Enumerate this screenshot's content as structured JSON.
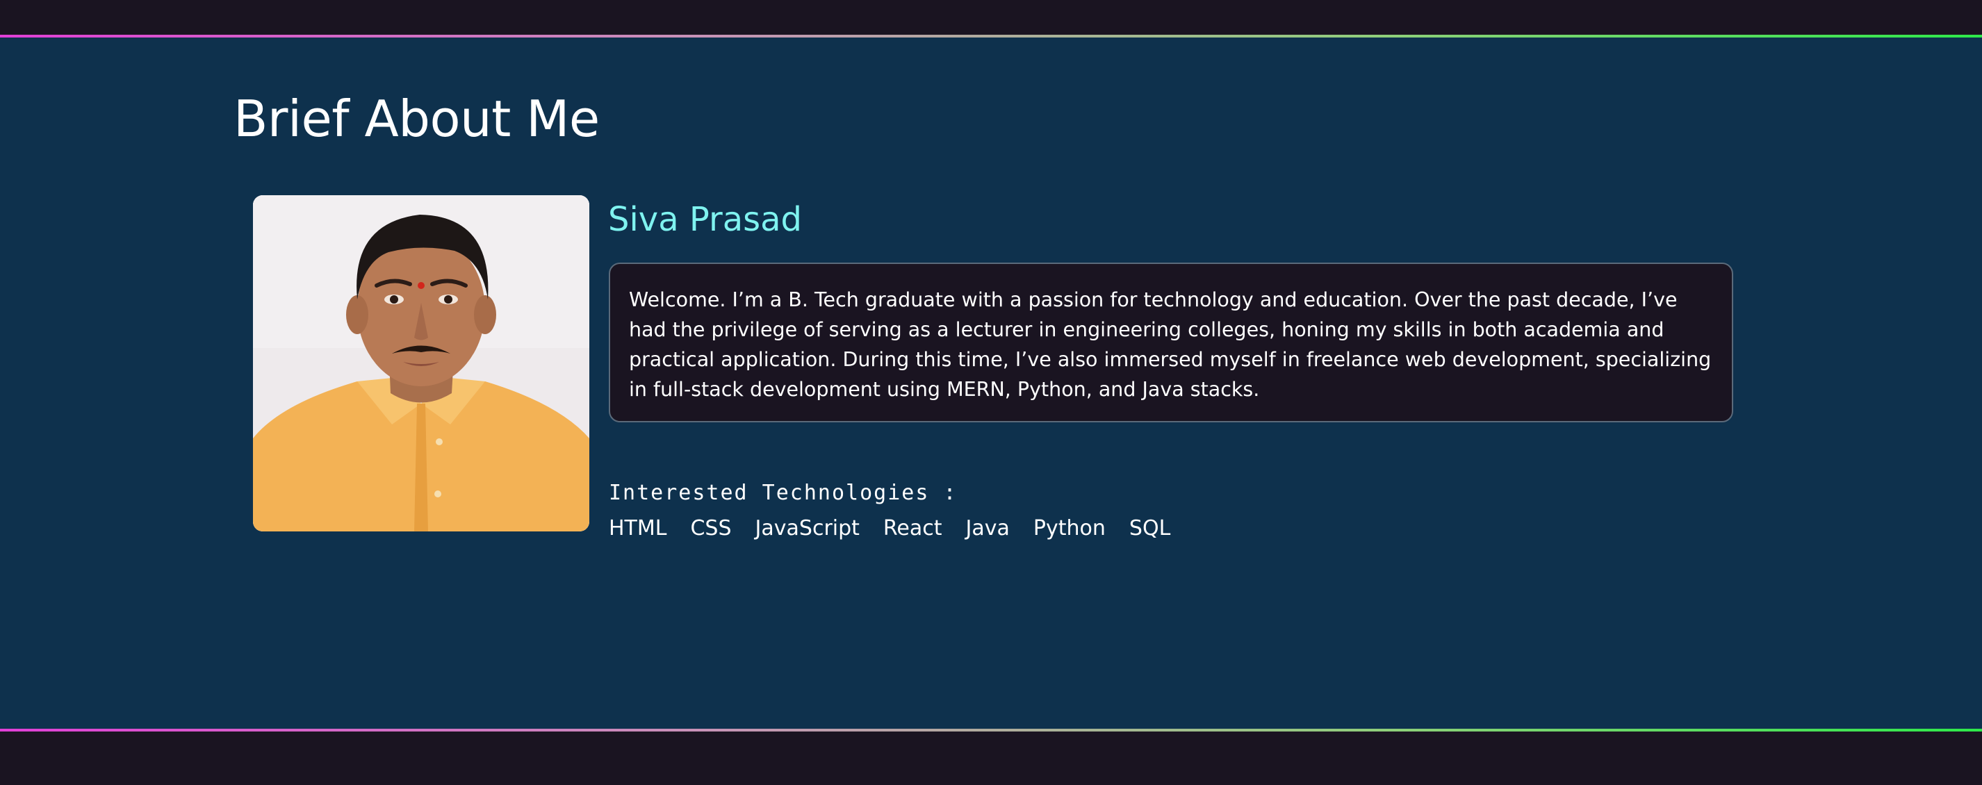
{
  "about": {
    "title": "Brief About Me",
    "name": "Siva Prasad",
    "bio": "Welcome. I’m a B. Tech graduate with a passion for technology and education. Over the past decade, I’ve had the privilege of serving as a lecturer in engineering colleges, honing my skills in both academia and practical application. During this time, I’ve also immersed myself in freelance web development, specializing in full-stack development using MERN, Python, and Java stacks.",
    "technologies_label": "Interested Technologies :",
    "technologies": [
      "HTML",
      "CSS",
      "JavaScript",
      "React",
      "Java",
      "Python",
      "SQL"
    ]
  },
  "colors": {
    "page_background": "#0e314d",
    "bar_background": "#1a1421",
    "name_color": "#7ff3f0",
    "gradient_start": "#e03fd6",
    "gradient_end": "#2ee84a"
  }
}
